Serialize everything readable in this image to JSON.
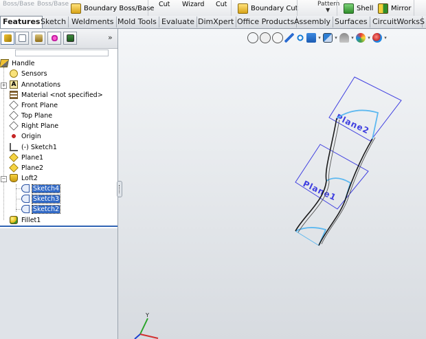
{
  "ribbon": {
    "top_left_1": "Boss/Base",
    "top_left_2": "Boss/Base",
    "boundary_boss": "Boundary Boss/Base",
    "cut_1": "Cut",
    "wizard": "Wizard",
    "cut_2": "Cut",
    "boundary_cut": "Boundary Cut",
    "pattern": "Pattern",
    "shell": "Shell",
    "mirror": "Mirror"
  },
  "tabs": [
    "Features",
    "Sketch",
    "Weldments",
    "Mold Tools",
    "Evaluate",
    "DimXpert",
    "Office Products",
    "Assembly",
    "Surfaces",
    "CircuitWorks",
    "S"
  ],
  "active_tab": "Features",
  "panel": {
    "more_symbol": "»",
    "tree": [
      {
        "label": "Handle",
        "icon": "part-icon"
      },
      {
        "label": "Sensors",
        "icon": "sensor-icon"
      },
      {
        "label": "Annotations",
        "icon": "annotations-icon"
      },
      {
        "label": "Material <not specified>",
        "icon": "material-icon"
      },
      {
        "label": "Front Plane",
        "icon": "plane-icon"
      },
      {
        "label": "Top Plane",
        "icon": "plane-icon"
      },
      {
        "label": "Right Plane",
        "icon": "plane-icon"
      },
      {
        "label": "Origin",
        "icon": "origin-icon"
      },
      {
        "label": "(-) Sketch1",
        "icon": "sketch-icon"
      },
      {
        "label": "Plane1",
        "icon": "ref-plane-icon"
      },
      {
        "label": "Plane2",
        "icon": "ref-plane-icon"
      },
      {
        "label": "Loft2",
        "icon": "loft-icon"
      },
      {
        "label": "Sketch4",
        "icon": "sketch-icon",
        "selected": true
      },
      {
        "label": "Sketch3",
        "icon": "sketch-icon",
        "selected": true
      },
      {
        "label": "Sketch2",
        "icon": "sketch-icon",
        "selected": true
      },
      {
        "label": "Fillet1",
        "icon": "fillet-icon"
      }
    ]
  },
  "view": {
    "plane_label_top": "Plane2",
    "plane_label_mid": "Plane1",
    "triad_axis_y": "Y",
    "colors": {
      "plane": "#3f3fe0",
      "sketch": "#5cb8f0",
      "loft_edge": "#1a1a1a"
    }
  }
}
